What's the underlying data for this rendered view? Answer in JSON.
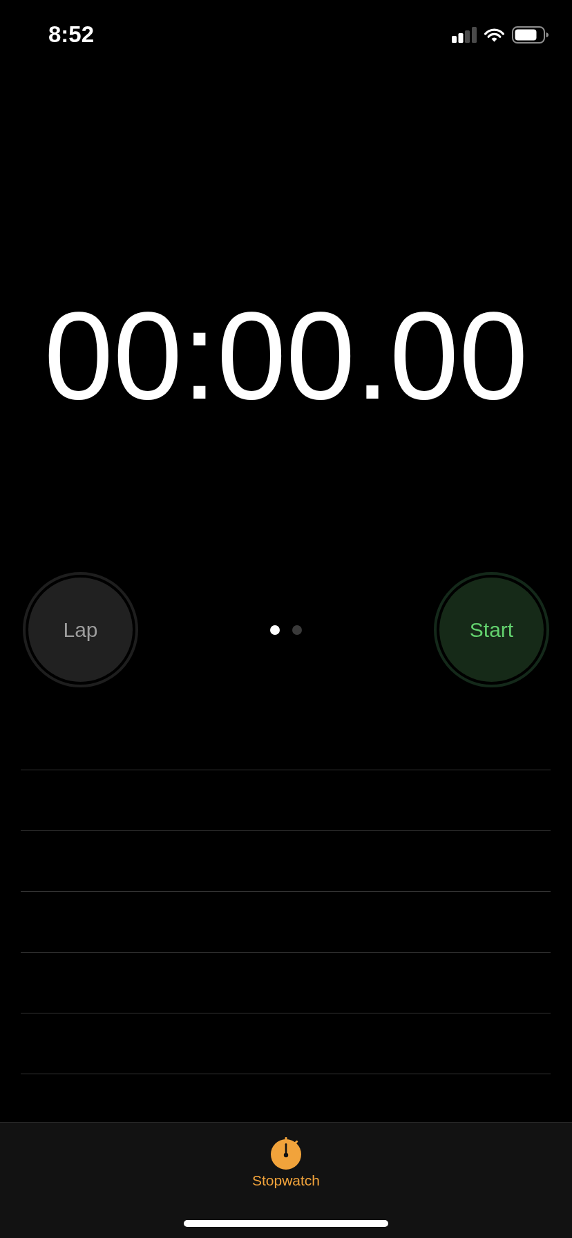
{
  "status_bar": {
    "time": "8:52"
  },
  "timer": {
    "display": "00:00.00"
  },
  "controls": {
    "buttons": [
      {
        "label": "Lap",
        "kind": "lap",
        "disabled": true
      },
      {
        "label": "Start",
        "kind": "start",
        "disabled": false
      }
    ],
    "page_dots": [
      {
        "selected": true
      },
      {
        "selected": false
      }
    ]
  },
  "tab_bar": {
    "tabs": [
      {
        "label": "Stopwatch",
        "selected": true
      }
    ]
  }
}
